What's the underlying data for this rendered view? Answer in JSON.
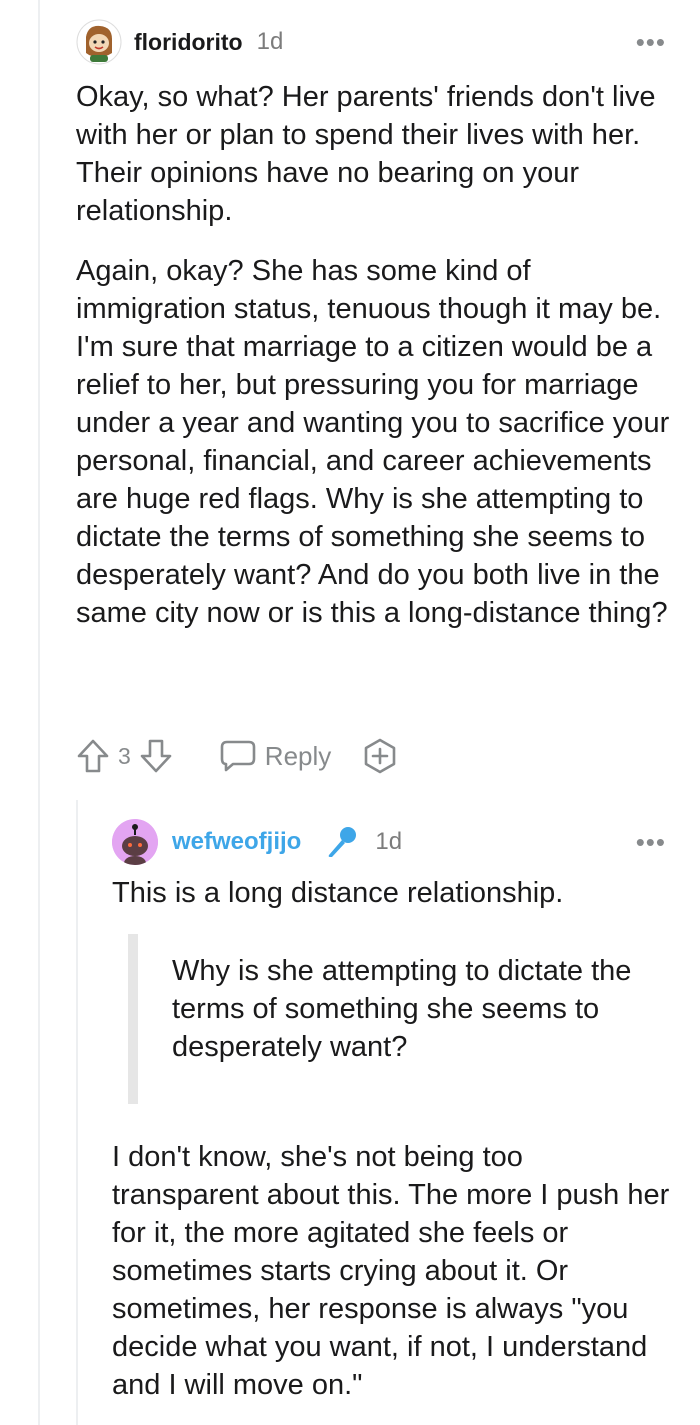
{
  "comment1": {
    "username": "floridorito",
    "time": "1d",
    "more": "•••",
    "paragraphs": [
      "Okay, so what? Her parents' friends don't live with her or plan to spend their lives with her. Their opinions have no bearing on your relationship.",
      "Again, okay? She has some kind of immigration status, tenuous though it may be. I'm sure that marriage to a citizen would be a relief to her, but pressuring you for marriage under a year and wanting you to sacrifice your personal, financial, and career achievements are huge red flags. Why is she attempting to dictate the terms of something she seems to desperately want? And do you both live in the same city now or is this a long-distance thing?"
    ],
    "actions": {
      "score": "3",
      "reply_label": "Reply"
    }
  },
  "comment2": {
    "username": "wefweofjijo",
    "time": "1d",
    "more": "•••",
    "line1": "This is a long distance relationship.",
    "quote": "Why is she attempting to dictate the terms of something she seems to desperately want?",
    "paragraph": "I don't know, she's not being too transparent about this. The more I push her for it, the more agitated she feels or sometimes starts crying about it. Or sometimes, her response is always \"you decide what you want, if not, I understand and I will move on.\""
  },
  "colors": {
    "op_blue": "#3ea6e8",
    "muted": "#878a8c",
    "thread": "#edeff1"
  }
}
